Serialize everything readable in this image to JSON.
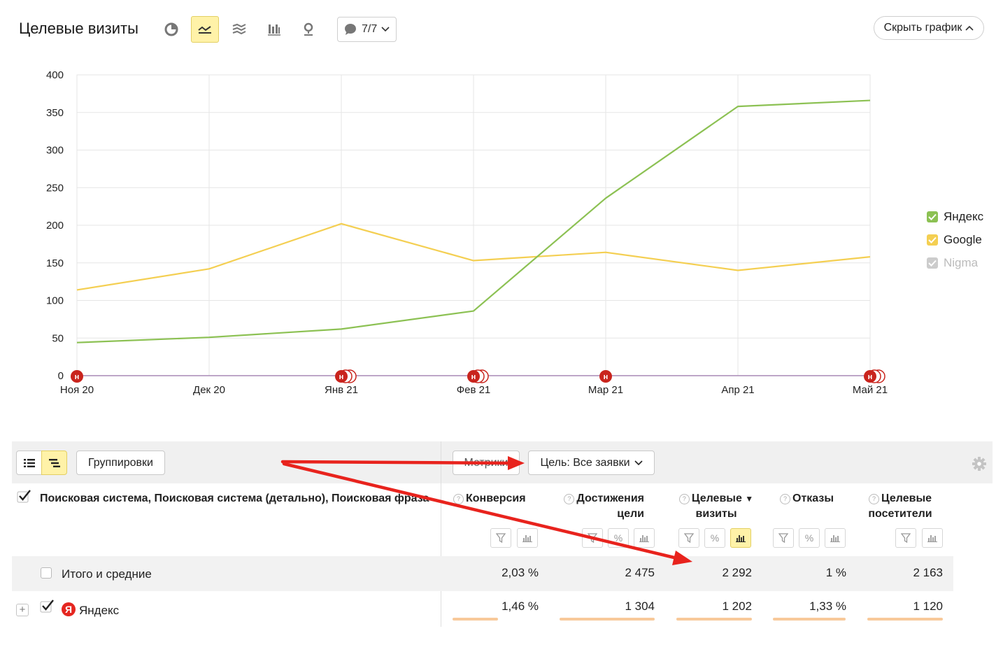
{
  "header": {
    "title": "Целевые визиты",
    "notes_count": "7/7",
    "hide_chart_label": "Скрыть график",
    "toolbar_icons": [
      "pie-chart-icon",
      "line-chart-icon",
      "area-chart-icon",
      "bar-chart-icon",
      "map-marker-icon"
    ]
  },
  "chart_data": {
    "type": "line",
    "x": [
      "Ноя 20",
      "Дек 20",
      "Янв 21",
      "Фев 21",
      "Мар 21",
      "Апр 21",
      "Май 21"
    ],
    "y_ticks": [
      "0",
      "50",
      "100",
      "150",
      "200",
      "250",
      "300",
      "350",
      "400"
    ],
    "ylim": [
      0,
      400
    ],
    "grid": true,
    "legend_position": "right",
    "series": [
      {
        "name": "Яндекс",
        "color": "#8cc153",
        "checked": true,
        "values": [
          44,
          51,
          62,
          86,
          236,
          358,
          366
        ]
      },
      {
        "name": "Google",
        "color": "#f4cf52",
        "checked": true,
        "values": [
          114,
          142,
          202,
          153,
          164,
          140,
          158
        ]
      },
      {
        "name": "Nigma",
        "color": "#cccccc",
        "checked": true,
        "values": [
          0,
          0,
          0,
          0,
          0,
          0,
          0
        ]
      }
    ],
    "note_marker_label": "н",
    "note_markers": [
      {
        "x": "Ноя 20",
        "count": 1
      },
      {
        "x": "Янв 21",
        "count": 3
      },
      {
        "x": "Фев 21",
        "count": 3
      },
      {
        "x": "Мар 21",
        "count": 1
      },
      {
        "x": "Май 21",
        "count": 3
      }
    ]
  },
  "table": {
    "groupings_label": "Группировки",
    "metrics_label": "Метрики",
    "goal_label": "Цель: Все заявки",
    "dimensions_header": "Поисковая система, Поисковая система (детально), Поисковая фраза",
    "columns": [
      {
        "line1": "Конверсия",
        "line2": "",
        "sort": ""
      },
      {
        "line1": "Достижения",
        "line2": "цели",
        "sort": ""
      },
      {
        "line1": "Целевые",
        "line2": "визиты",
        "sort": "▼"
      },
      {
        "line1": "Отказы",
        "line2": "",
        "sort": ""
      },
      {
        "line1": "Целевые",
        "line2": "посетители",
        "sort": ""
      }
    ],
    "totals": {
      "label": "Итого и средние",
      "values": [
        "2,03 %",
        "2 475",
        "2 292",
        "1 %",
        "2 163"
      ]
    },
    "rows": [
      {
        "label": "Яндекс",
        "logo_letter": "Я",
        "values": [
          "1,46 %",
          "1 304",
          "1 202",
          "1,33 %",
          "1 120"
        ]
      }
    ]
  }
}
